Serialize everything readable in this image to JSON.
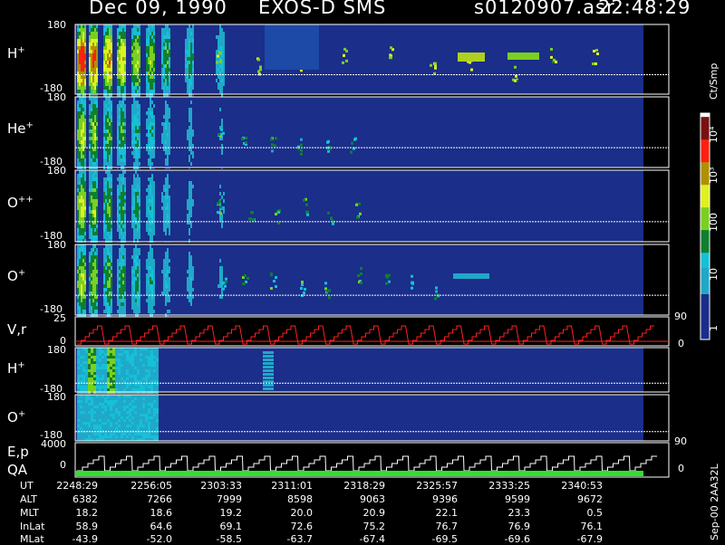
{
  "header": {
    "date": "Dec 09, 1990",
    "instrument": "EXOS-D SMS",
    "file": "s0120907.asr",
    "time": "22:48:29"
  },
  "colors": {
    "background": "#000000",
    "plot_background": "#1a2e8a",
    "line_red": "#ff2020",
    "line_white": "#ffffff",
    "line_green": "#30e030"
  },
  "colorbar": {
    "unit": "Ct/Smp",
    "labels": [
      "10⁴",
      "10³",
      "100",
      "10",
      "1"
    ],
    "scale": "log",
    "range": [
      1,
      10000
    ]
  },
  "chart_data": [
    {
      "type": "heatmap",
      "label": "H",
      "charge": "+",
      "ylim_labels": [
        "180",
        "-180"
      ]
    },
    {
      "type": "heatmap",
      "label": "He",
      "charge": "+",
      "ylim_labels": [
        "180",
        "-180"
      ]
    },
    {
      "type": "heatmap",
      "label": "O",
      "charge": "++",
      "ylim_labels": [
        "180",
        "-180"
      ]
    },
    {
      "type": "heatmap",
      "label": "O",
      "charge": "+",
      "ylim_labels": [
        "180",
        "-180"
      ]
    },
    {
      "type": "line",
      "label": "V,r",
      "left_labels": [
        "25",
        "0"
      ],
      "right_labels": [
        "90",
        "0"
      ]
    },
    {
      "type": "heatmap",
      "label": "H",
      "charge": "+",
      "ylim_labels": [
        "180",
        "-180"
      ]
    },
    {
      "type": "heatmap",
      "label": "O",
      "charge": "+",
      "ylim_labels": [
        "180",
        "-180"
      ]
    },
    {
      "type": "line",
      "label": "E,p",
      "label2": "QA",
      "left_labels": [
        "4000",
        "0"
      ],
      "right_labels": [
        "90",
        "0"
      ]
    }
  ],
  "ephemeris": {
    "labels": [
      "UT",
      "ALT",
      "MLT",
      "InLat",
      "MLat"
    ],
    "columns": [
      {
        "UT": "2248:29",
        "ALT": "6382",
        "MLT": "18.2",
        "InLat": "58.9",
        "MLat": "-43.9"
      },
      {
        "UT": "2256:05",
        "ALT": "7266",
        "MLT": "18.6",
        "InLat": "64.6",
        "MLat": "-52.0"
      },
      {
        "UT": "2303:33",
        "ALT": "7999",
        "MLT": "19.2",
        "InLat": "69.1",
        "MLat": "-58.5"
      },
      {
        "UT": "2311:01",
        "ALT": "8598",
        "MLT": "20.0",
        "InLat": "72.6",
        "MLat": "-63.7"
      },
      {
        "UT": "2318:29",
        "ALT": "9063",
        "MLT": "20.9",
        "InLat": "75.2",
        "MLat": "-67.4"
      },
      {
        "UT": "2325:57",
        "ALT": "9396",
        "MLT": "22.1",
        "InLat": "76.7",
        "MLat": "-69.5"
      },
      {
        "UT": "2333:25",
        "ALT": "9599",
        "MLT": "23.3",
        "InLat": "76.9",
        "MLat": "-69.6"
      },
      {
        "UT": "2340:53",
        "ALT": "9672",
        "MLT": "0.5",
        "InLat": "76.1",
        "MLat": "-67.9"
      }
    ]
  },
  "footer": {
    "stamp": "Sep-00 2AA32L"
  }
}
